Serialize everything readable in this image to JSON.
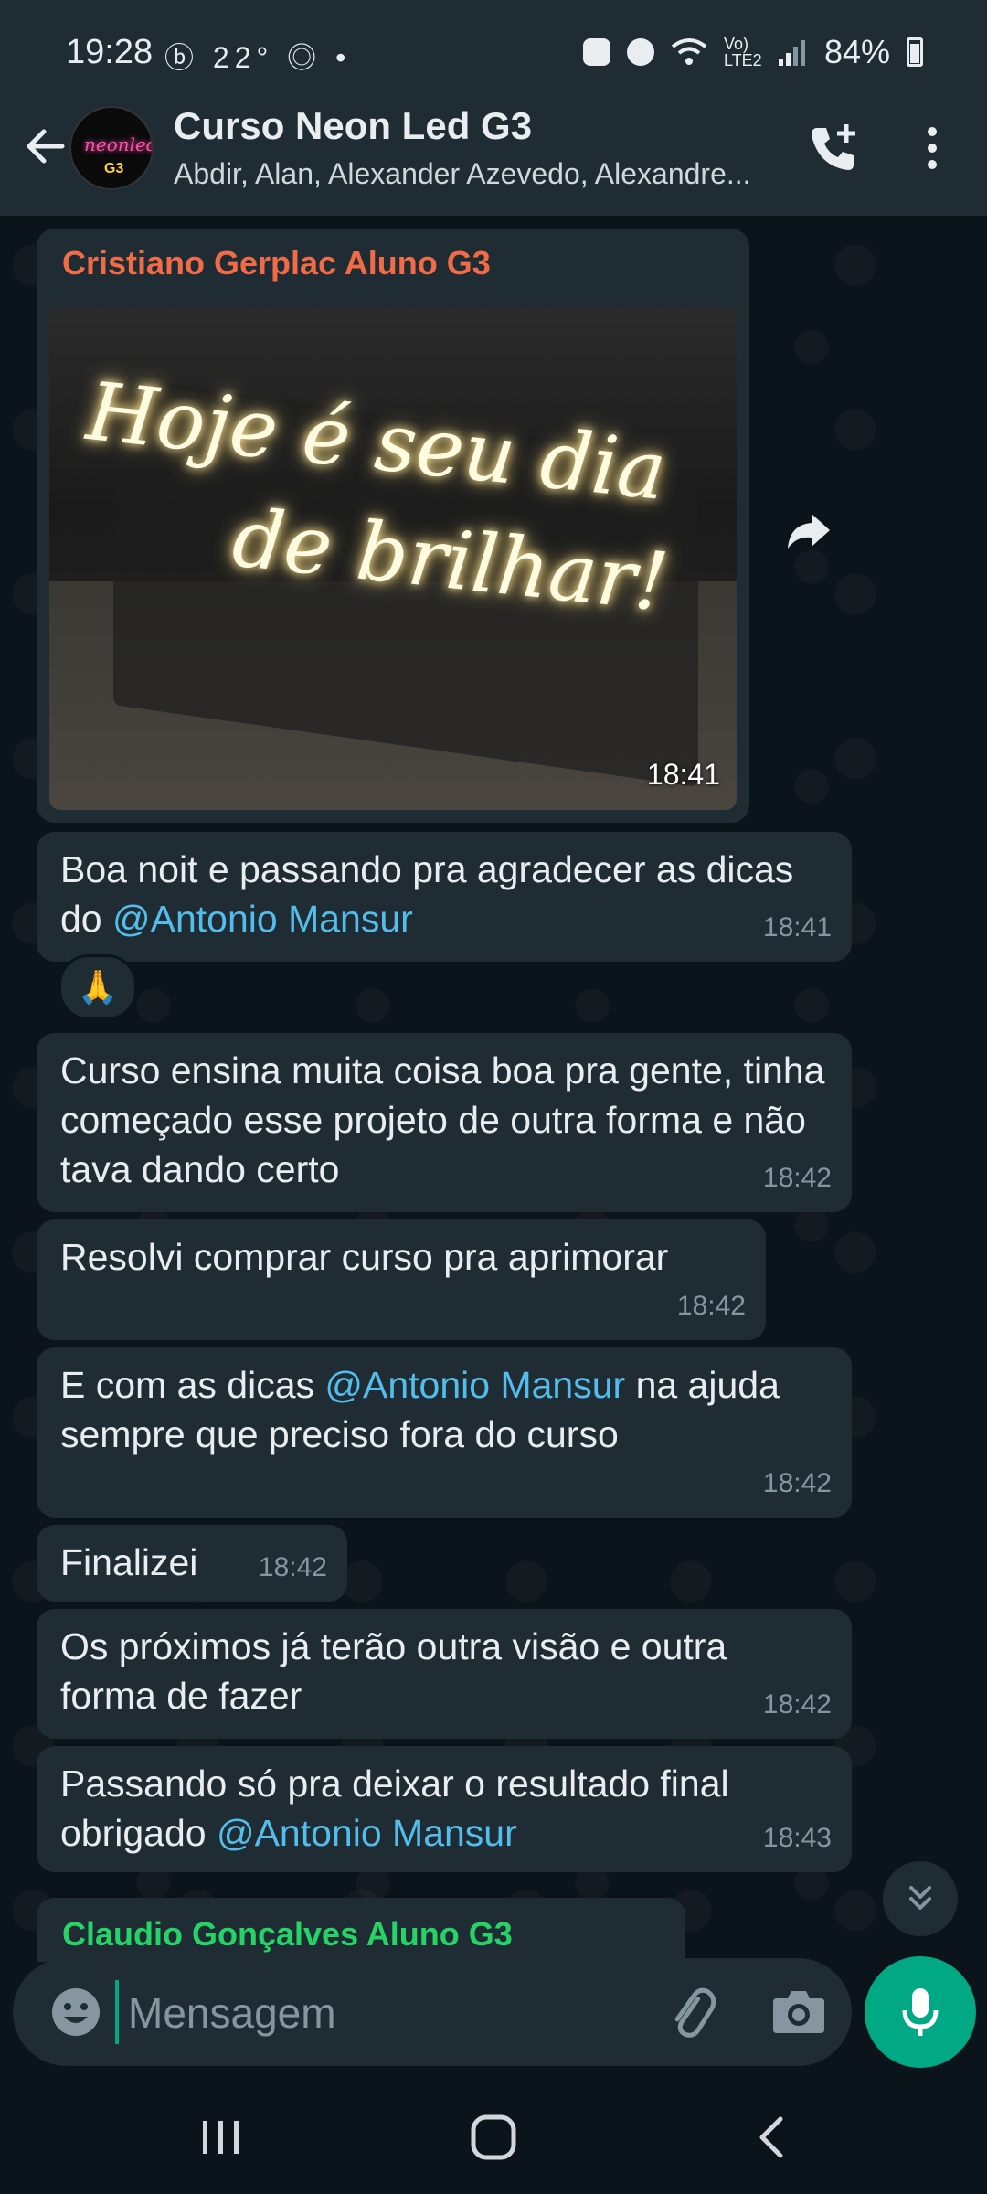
{
  "status_bar": {
    "time": "19:28",
    "left_icons": "ⓑ 22° ◎ •",
    "signal": "Vo) LTE2",
    "battery": "84%"
  },
  "header": {
    "title": "Curso Neon Led G3",
    "subtitle": "Abdir, Alan, Alexander Azevedo, Alexandre...",
    "avatar_text": "neonled",
    "avatar_badge": "G3"
  },
  "messages": [
    {
      "sender": "Cristiano Gerplac Aluno G3",
      "sender_color": "#f26b47",
      "image_caption_line1": "Hoje é seu dia",
      "image_caption_line2": "de brilhar!",
      "time": "18:41"
    },
    {
      "text_before": "Boa noit e passando pra agradecer as dicas do ",
      "mention": "@Antonio Mansur",
      "text_after": "",
      "time": "18:41",
      "reaction": "🙏"
    },
    {
      "text": "Curso ensina muita coisa boa pra gente, tinha começado esse projeto de outra forma e não tava dando certo",
      "time": "18:42"
    },
    {
      "text": "Resolvi comprar curso pra aprimorar",
      "time": "18:42"
    },
    {
      "text_before": "E com as dicas ",
      "mention": "@Antonio Mansur",
      "text_after": " na ajuda sempre que preciso fora do curso",
      "time": "18:42"
    },
    {
      "text": "Finalizei",
      "time": "18:42"
    },
    {
      "text": "Os próximos já terão outra visão e outra forma de fazer",
      "time": "18:42"
    },
    {
      "text_before": "Passando só pra deixar o resultado final obrigado ",
      "mention": "@Antonio Mansur",
      "text_after": "",
      "time": "18:43"
    },
    {
      "sender": "Claudio Gonçalves Aluno G3",
      "sender_color": "#25d366"
    }
  ],
  "input": {
    "placeholder": "Mensagem"
  },
  "colors": {
    "header_bg": "#1f2c34",
    "chat_bg": "#0b141a",
    "bubble_bg": "#1f2c34",
    "accent": "#00a884",
    "mention": "#53bdeb"
  }
}
